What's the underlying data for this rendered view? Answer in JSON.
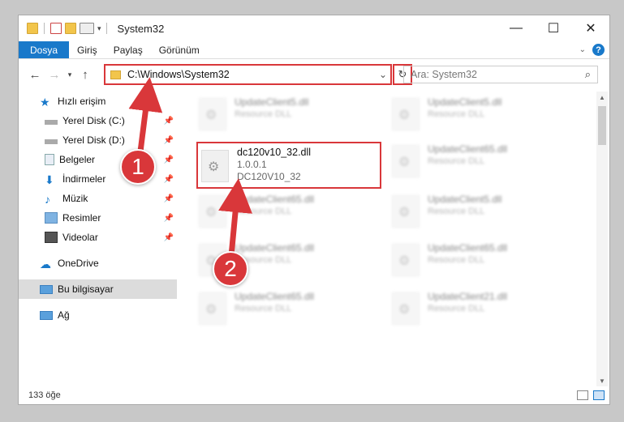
{
  "window": {
    "title": "System32"
  },
  "ribbon": {
    "tabs": [
      "Dosya",
      "Giriş",
      "Paylaş",
      "Görünüm"
    ],
    "help": "?"
  },
  "address": {
    "path": "C:\\Windows\\System32"
  },
  "search": {
    "placeholder": "Ara: System32"
  },
  "nav": {
    "quick_access": "Hızlı erişim",
    "items": [
      {
        "label": "Yerel Disk (C:)",
        "icon": "drive-icon"
      },
      {
        "label": "Yerel Disk (D:)",
        "icon": "drive-icon"
      },
      {
        "label": "Belgeler",
        "icon": "documents-icon"
      },
      {
        "label": "İndirmeler",
        "icon": "downloads-icon"
      },
      {
        "label": "Müzik",
        "icon": "music-icon"
      },
      {
        "label": "Resimler",
        "icon": "pictures-icon"
      },
      {
        "label": "Videolar",
        "icon": "videos-icon"
      }
    ],
    "onedrive": "OneDrive",
    "this_pc": "Bu bilgisayar",
    "network": "Ağ"
  },
  "files": [
    {
      "name": "UpdateClient5.dll",
      "sub": "Resource DLL"
    },
    {
      "name": "UpdateClient5.dll",
      "sub": "Resource DLL"
    },
    {
      "name": "UpdateClient65.dll",
      "sub": "Resource DLL"
    },
    {
      "name": "UpdateClient65.dll",
      "sub": "Resource DLL"
    },
    {
      "name": "UpdateClient5.dll",
      "sub": "Resource DLL"
    },
    {
      "name": "UpdateClient65.dll",
      "sub": "Resource DLL"
    },
    {
      "name": "UpdateClient65.dll",
      "sub": "Resource DLL"
    },
    {
      "name": "UpdateClient65.dll",
      "sub": "Resource DLL"
    },
    {
      "name": "UpdateClient21.dll",
      "sub": "Resource DLL"
    }
  ],
  "target_file": {
    "name": "dc120v10_32.dll",
    "version": "1.0.0.1",
    "description": "DC120V10_32"
  },
  "status": {
    "count": "133 öğe"
  },
  "badges": [
    "1",
    "2"
  ],
  "colors": {
    "accent": "#1979ca",
    "highlight": "#d9373a"
  }
}
